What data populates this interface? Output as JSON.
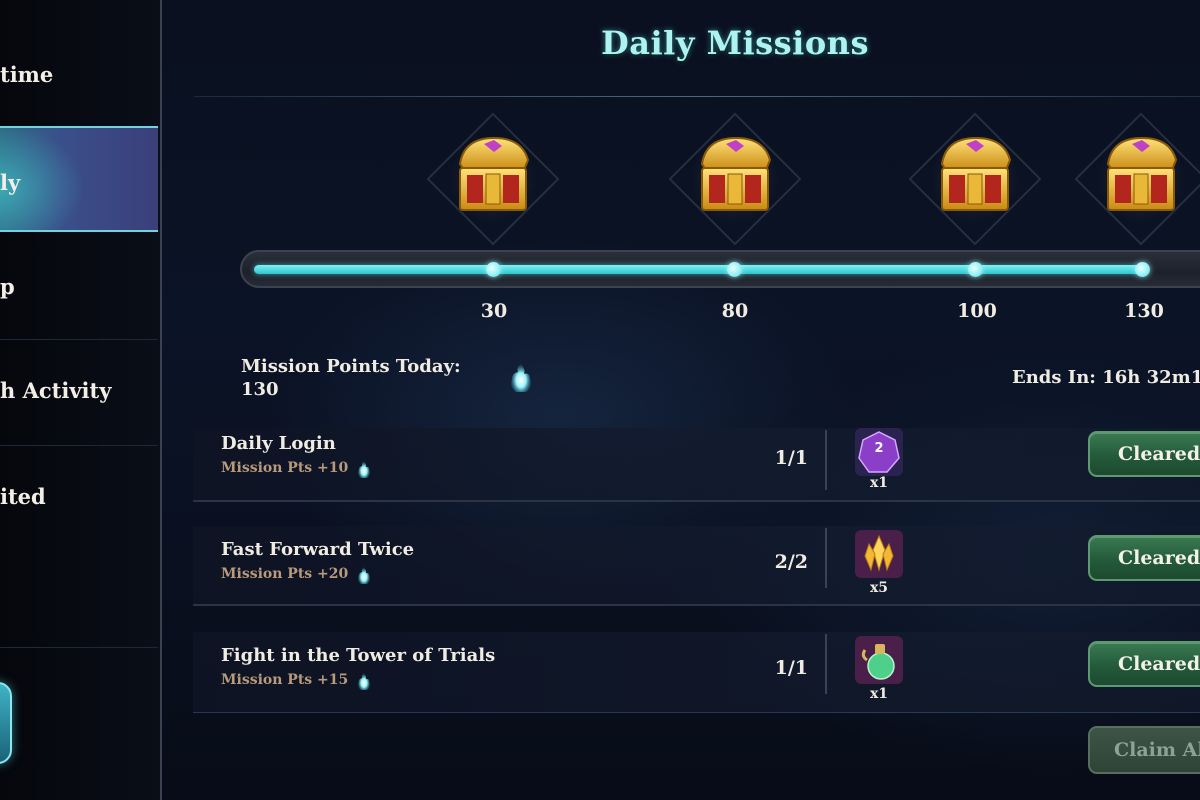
{
  "sidebar": {
    "items": [
      {
        "label": "time"
      },
      {
        "label": "ly",
        "active": true
      },
      {
        "label": "p"
      },
      {
        "label": "h Activity"
      },
      {
        "label": "ited"
      }
    ]
  },
  "header": {
    "title": "Daily Missions"
  },
  "progress": {
    "current": 130,
    "max": 130,
    "milestones": [
      {
        "value": 30,
        "label": "30",
        "icon": "treasure-chest-icon"
      },
      {
        "value": 80,
        "label": "80",
        "icon": "treasure-chest-icon"
      },
      {
        "value": 100,
        "label": "100",
        "icon": "treasure-chest-icon"
      },
      {
        "value": 130,
        "label": "130",
        "icon": "treasure-chest-icon"
      }
    ]
  },
  "points": {
    "label": "Mission Points Today:",
    "value": "130",
    "icon": "spirit-orb-icon"
  },
  "timer": {
    "label": "Ends In: 16h 32m1"
  },
  "missions": [
    {
      "name": "Daily Login",
      "points": "Mission Pts +10",
      "count": "1/1",
      "reward_icon": "purple-ticket-icon",
      "reward_qty": "x1",
      "button": "Cleared"
    },
    {
      "name": "Fast Forward Twice",
      "points": "Mission Pts +20",
      "count": "2/2",
      "reward_icon": "gold-crystal-icon",
      "reward_qty": "x5",
      "button": "Cleared"
    },
    {
      "name": "Fight in the Tower of Trials",
      "points": "Mission Pts +15",
      "count": "1/1",
      "reward_icon": "green-potion-icon",
      "reward_qty": "x1",
      "button": "Cleared"
    }
  ],
  "claim_all": {
    "label": "Claim All",
    "enabled": false
  },
  "colors": {
    "title": "#aef3f0",
    "progress_fill": "#2ec4cf",
    "cleared_button": "#245a3a",
    "points_text": "#b89a7c"
  }
}
